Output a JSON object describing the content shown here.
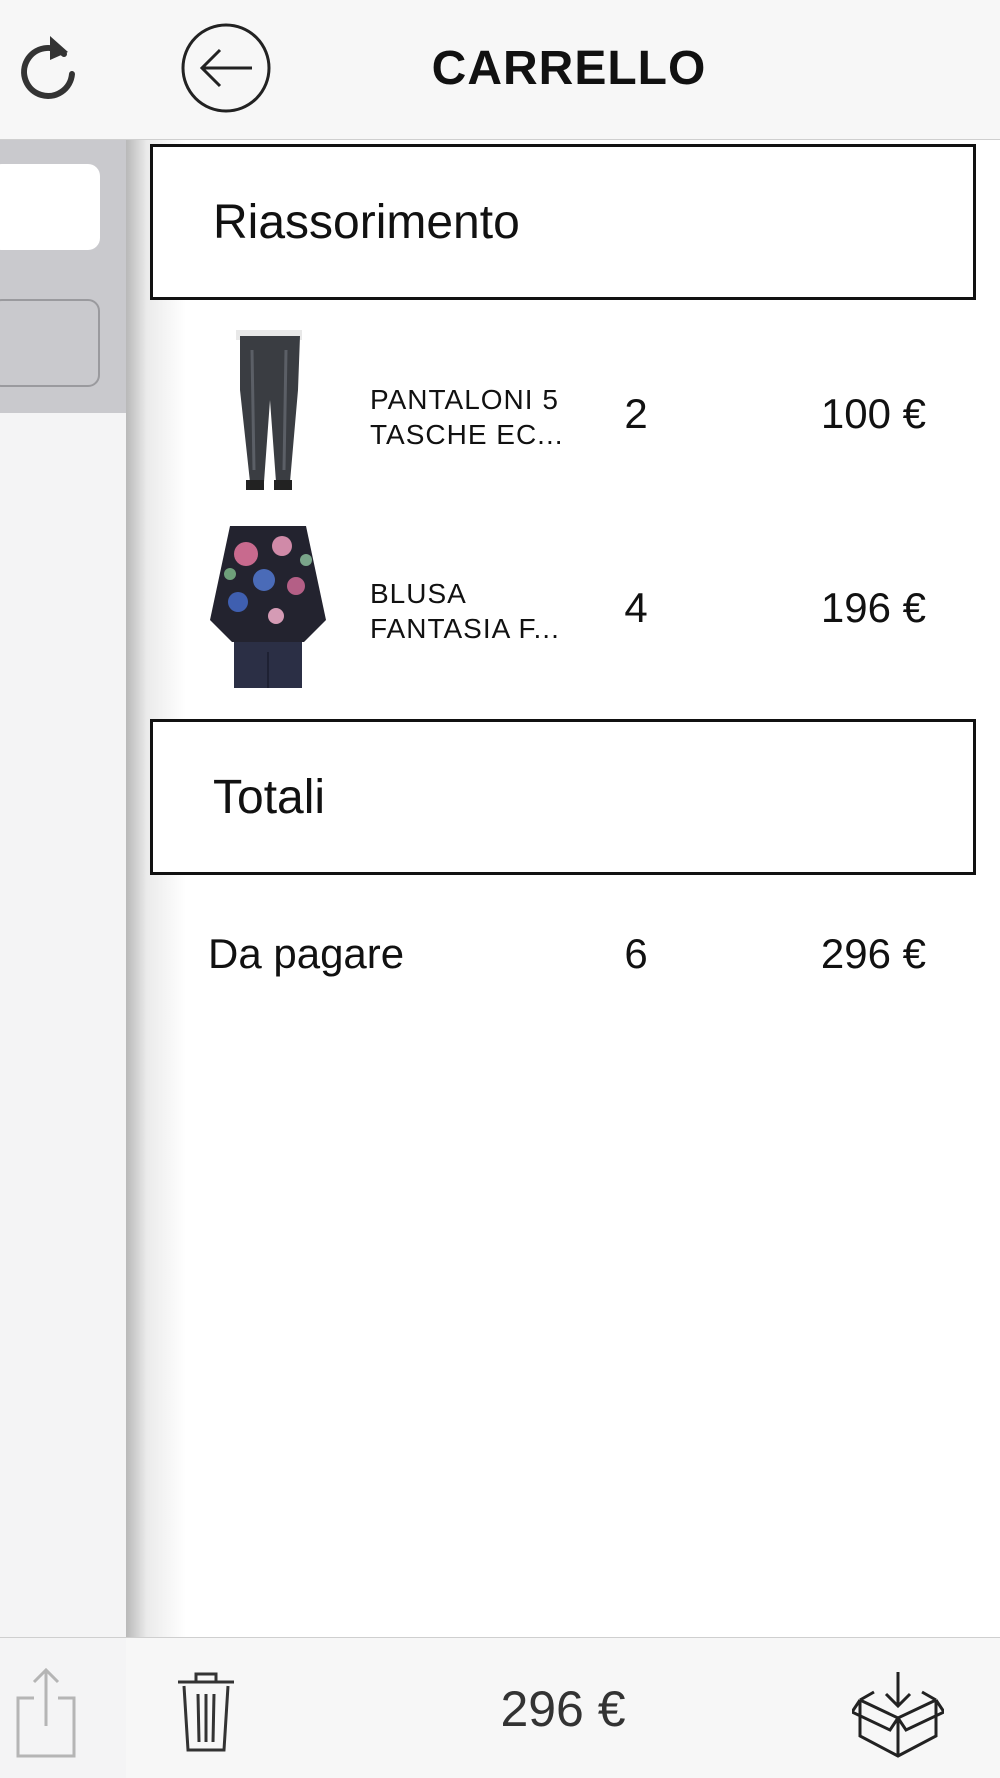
{
  "header": {
    "title": "CARRELLO"
  },
  "sections": {
    "reassortment": "Riassorimento",
    "totals": "Totali"
  },
  "items": [
    {
      "name_line1": "PANTALONI 5",
      "name_line2": "TASCHE EC...",
      "qty": "2",
      "price": "100 €",
      "thumb": "pants-image"
    },
    {
      "name_line1": "BLUSA",
      "name_line2": "FANTASIA F...",
      "qty": "4",
      "price": "196 €",
      "thumb": "floral-blouse-image"
    }
  ],
  "totals": {
    "label": "Da pagare",
    "qty": "6",
    "price": "296 €"
  },
  "footer": {
    "total": "296 €"
  },
  "icons": {
    "refresh": "refresh-icon",
    "back": "back-arrow-icon",
    "share": "share-icon",
    "trash": "trash-icon",
    "order": "box-download-icon"
  }
}
